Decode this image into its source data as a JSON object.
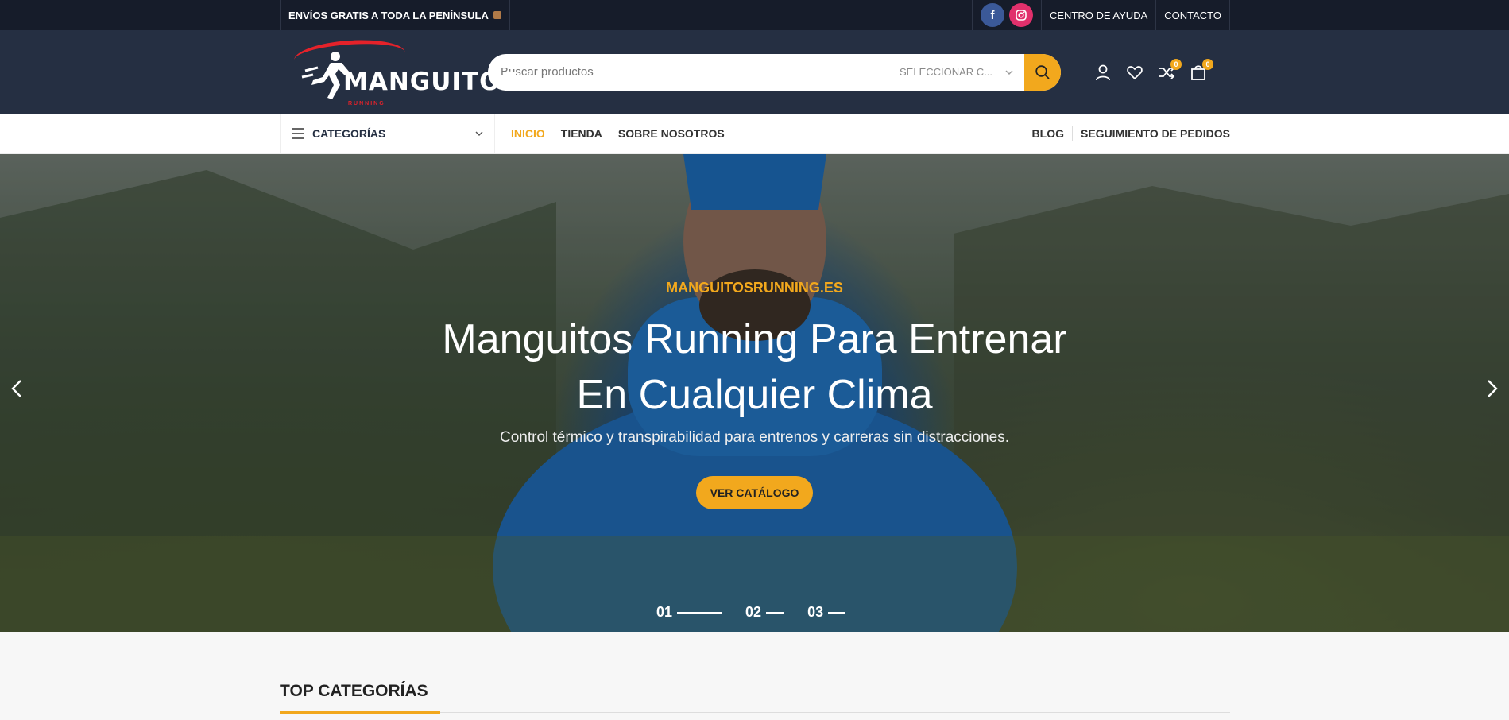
{
  "topbar": {
    "promo": "ENVÍOS GRATIS A TODA LA PENÍNSULA",
    "help_link": "CENTRO DE AYUDA",
    "contact_link": "CONTACTO",
    "social": [
      "facebook-icon",
      "instagram-icon"
    ]
  },
  "header": {
    "logo_text": "MANGUITOS",
    "logo_sub": "RUNNING",
    "search_placeholder": "Buscar productos",
    "category_select": "SELECCIONAR C...",
    "compare_count": "0",
    "cart_count": "0"
  },
  "nav": {
    "categories_label": "CATEGORÍAS",
    "items": [
      {
        "label": "INICIO",
        "active": true
      },
      {
        "label": "TIENDA",
        "active": false
      },
      {
        "label": "SOBRE NOSOTROS",
        "active": false
      }
    ],
    "right_items": [
      "BLOG",
      "SEGUIMIENTO DE PEDIDOS"
    ]
  },
  "hero": {
    "kicker": "MANGUITOSRUNNING.ES",
    "title_line1": "Manguitos Running Para Entrenar",
    "title_line2": "En Cualquier Clima",
    "subtitle": "Control térmico y transpirabilidad para entrenos y carreras sin distracciones.",
    "button": "VER CATÁLOGO",
    "slides": [
      "01",
      "02",
      "03"
    ]
  },
  "section": {
    "title": "TOP CATEGORÍAS"
  },
  "colors": {
    "accent": "#f2a81d",
    "topbar_bg": "#161c2a",
    "header_bg": "#252f42"
  }
}
